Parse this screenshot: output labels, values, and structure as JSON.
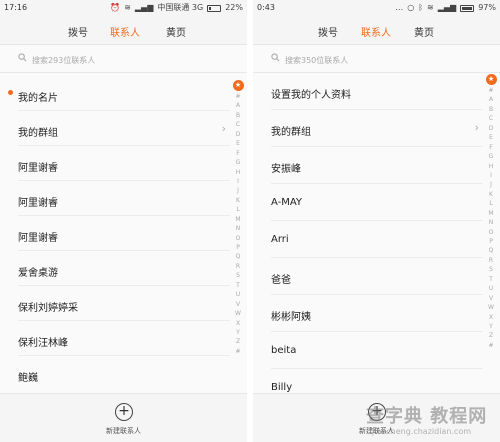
{
  "left": {
    "status": {
      "time": "17:16",
      "carrier": "中国联通 3G",
      "battery": "22%",
      "battery_level": 0.22
    },
    "tabs": [
      "拨号",
      "联系人",
      "黄页"
    ],
    "active_tab": 1,
    "search_placeholder": "搜索293位联系人",
    "contacts": [
      "我的名片",
      "我的群组",
      "阿里谢睿",
      "阿里谢睿",
      "阿里谢睿",
      "爱舍桌游",
      "保利刘婷婷采",
      "保利汪林峰",
      "鲍巍"
    ],
    "add_label": "新建联系人"
  },
  "right": {
    "status": {
      "time": "0:43",
      "battery": "97%",
      "battery_level": 0.97
    },
    "tabs": [
      "拨号",
      "联系人",
      "黄页"
    ],
    "active_tab": 1,
    "search_placeholder": "搜索350位联系人",
    "contacts": [
      "设置我的个人资料",
      "我的群组",
      "安振峰",
      "A-MAY",
      "Arri",
      "爸爸",
      "彬彬阿姨",
      "beita",
      "Billy"
    ],
    "add_label": "新建联系人"
  },
  "index_letters": [
    "#",
    "A",
    "B",
    "C",
    "D",
    "E",
    "F",
    "G",
    "H",
    "I",
    "J",
    "K",
    "L",
    "M",
    "N",
    "O",
    "P",
    "Q",
    "R",
    "S",
    "T",
    "U",
    "V",
    "W",
    "X",
    "Y",
    "Z",
    "#"
  ],
  "index_star": "★",
  "watermark": {
    "main": "查字典 教程网",
    "sub": "jiaocheng.chazidian.com"
  },
  "accent": "#f26b1d"
}
